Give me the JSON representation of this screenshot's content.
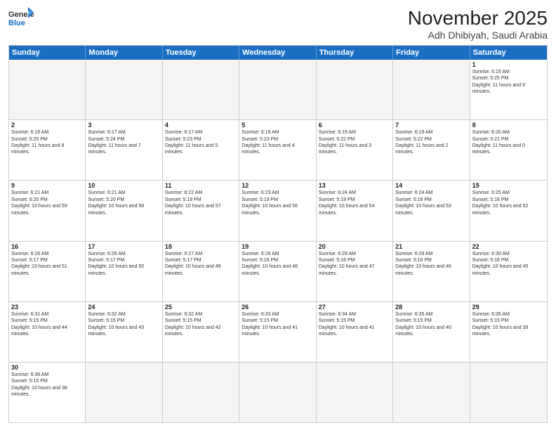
{
  "header": {
    "logo_general": "General",
    "logo_blue": "Blue",
    "month": "November 2025",
    "location": "Adh Dhibiyah, Saudi Arabia"
  },
  "days": [
    "Sunday",
    "Monday",
    "Tuesday",
    "Wednesday",
    "Thursday",
    "Friday",
    "Saturday"
  ],
  "weeks": [
    [
      {
        "day": "",
        "empty": true
      },
      {
        "day": "",
        "empty": true
      },
      {
        "day": "",
        "empty": true
      },
      {
        "day": "",
        "empty": true
      },
      {
        "day": "",
        "empty": true
      },
      {
        "day": "",
        "empty": true
      },
      {
        "day": "1",
        "rise": "6:15 AM",
        "set": "5:25 PM",
        "daylight": "11 hours and 9 minutes."
      }
    ],
    [
      {
        "day": "2",
        "rise": "6:16 AM",
        "set": "5:25 PM",
        "daylight": "11 hours and 8 minutes."
      },
      {
        "day": "3",
        "rise": "6:17 AM",
        "set": "5:24 PM",
        "daylight": "11 hours and 7 minutes."
      },
      {
        "day": "4",
        "rise": "6:17 AM",
        "set": "5:23 PM",
        "daylight": "11 hours and 5 minutes."
      },
      {
        "day": "5",
        "rise": "6:18 AM",
        "set": "5:23 PM",
        "daylight": "11 hours and 4 minutes."
      },
      {
        "day": "6",
        "rise": "6:19 AM",
        "set": "5:22 PM",
        "daylight": "11 hours and 3 minutes."
      },
      {
        "day": "7",
        "rise": "6:19 AM",
        "set": "5:22 PM",
        "daylight": "11 hours and 2 minutes."
      },
      {
        "day": "8",
        "rise": "6:20 AM",
        "set": "5:21 PM",
        "daylight": "11 hours and 0 minutes."
      }
    ],
    [
      {
        "day": "9",
        "rise": "6:21 AM",
        "set": "5:20 PM",
        "daylight": "10 hours and 59 minutes."
      },
      {
        "day": "10",
        "rise": "6:21 AM",
        "set": "5:20 PM",
        "daylight": "10 hours and 58 minutes."
      },
      {
        "day": "11",
        "rise": "6:22 AM",
        "set": "5:19 PM",
        "daylight": "10 hours and 57 minutes."
      },
      {
        "day": "12",
        "rise": "6:23 AM",
        "set": "5:19 PM",
        "daylight": "10 hours and 56 minutes."
      },
      {
        "day": "13",
        "rise": "6:24 AM",
        "set": "5:19 PM",
        "daylight": "10 hours and 54 minutes."
      },
      {
        "day": "14",
        "rise": "6:24 AM",
        "set": "5:18 PM",
        "daylight": "10 hours and 53 minutes."
      },
      {
        "day": "15",
        "rise": "6:25 AM",
        "set": "5:18 PM",
        "daylight": "10 hours and 52 minutes."
      }
    ],
    [
      {
        "day": "16",
        "rise": "6:26 AM",
        "set": "5:17 PM",
        "daylight": "10 hours and 51 minutes."
      },
      {
        "day": "17",
        "rise": "6:26 AM",
        "set": "5:17 PM",
        "daylight": "10 hours and 50 minutes."
      },
      {
        "day": "18",
        "rise": "6:27 AM",
        "set": "5:17 PM",
        "daylight": "10 hours and 49 minutes."
      },
      {
        "day": "19",
        "rise": "6:28 AM",
        "set": "5:16 PM",
        "daylight": "10 hours and 48 minutes."
      },
      {
        "day": "20",
        "rise": "6:29 AM",
        "set": "5:16 PM",
        "daylight": "10 hours and 47 minutes."
      },
      {
        "day": "21",
        "rise": "6:29 AM",
        "set": "5:16 PM",
        "daylight": "10 hours and 46 minutes."
      },
      {
        "day": "22",
        "rise": "6:30 AM",
        "set": "5:16 PM",
        "daylight": "10 hours and 45 minutes."
      }
    ],
    [
      {
        "day": "23",
        "rise": "6:31 AM",
        "set": "5:15 PM",
        "daylight": "10 hours and 44 minutes."
      },
      {
        "day": "24",
        "rise": "6:32 AM",
        "set": "5:15 PM",
        "daylight": "10 hours and 43 minutes."
      },
      {
        "day": "25",
        "rise": "6:32 AM",
        "set": "5:15 PM",
        "daylight": "10 hours and 42 minutes."
      },
      {
        "day": "26",
        "rise": "6:33 AM",
        "set": "5:15 PM",
        "daylight": "10 hours and 41 minutes."
      },
      {
        "day": "27",
        "rise": "6:34 AM",
        "set": "5:15 PM",
        "daylight": "10 hours and 41 minutes."
      },
      {
        "day": "28",
        "rise": "6:35 AM",
        "set": "5:15 PM",
        "daylight": "10 hours and 40 minutes."
      },
      {
        "day": "29",
        "rise": "6:35 AM",
        "set": "5:15 PM",
        "daylight": "10 hours and 39 minutes."
      }
    ],
    [
      {
        "day": "30",
        "rise": "6:36 AM",
        "set": "5:15 PM",
        "daylight": "10 hours and 38 minutes."
      },
      {
        "day": "",
        "empty": true
      },
      {
        "day": "",
        "empty": true
      },
      {
        "day": "",
        "empty": true
      },
      {
        "day": "",
        "empty": true
      },
      {
        "day": "",
        "empty": true
      },
      {
        "day": "",
        "empty": true
      }
    ]
  ]
}
